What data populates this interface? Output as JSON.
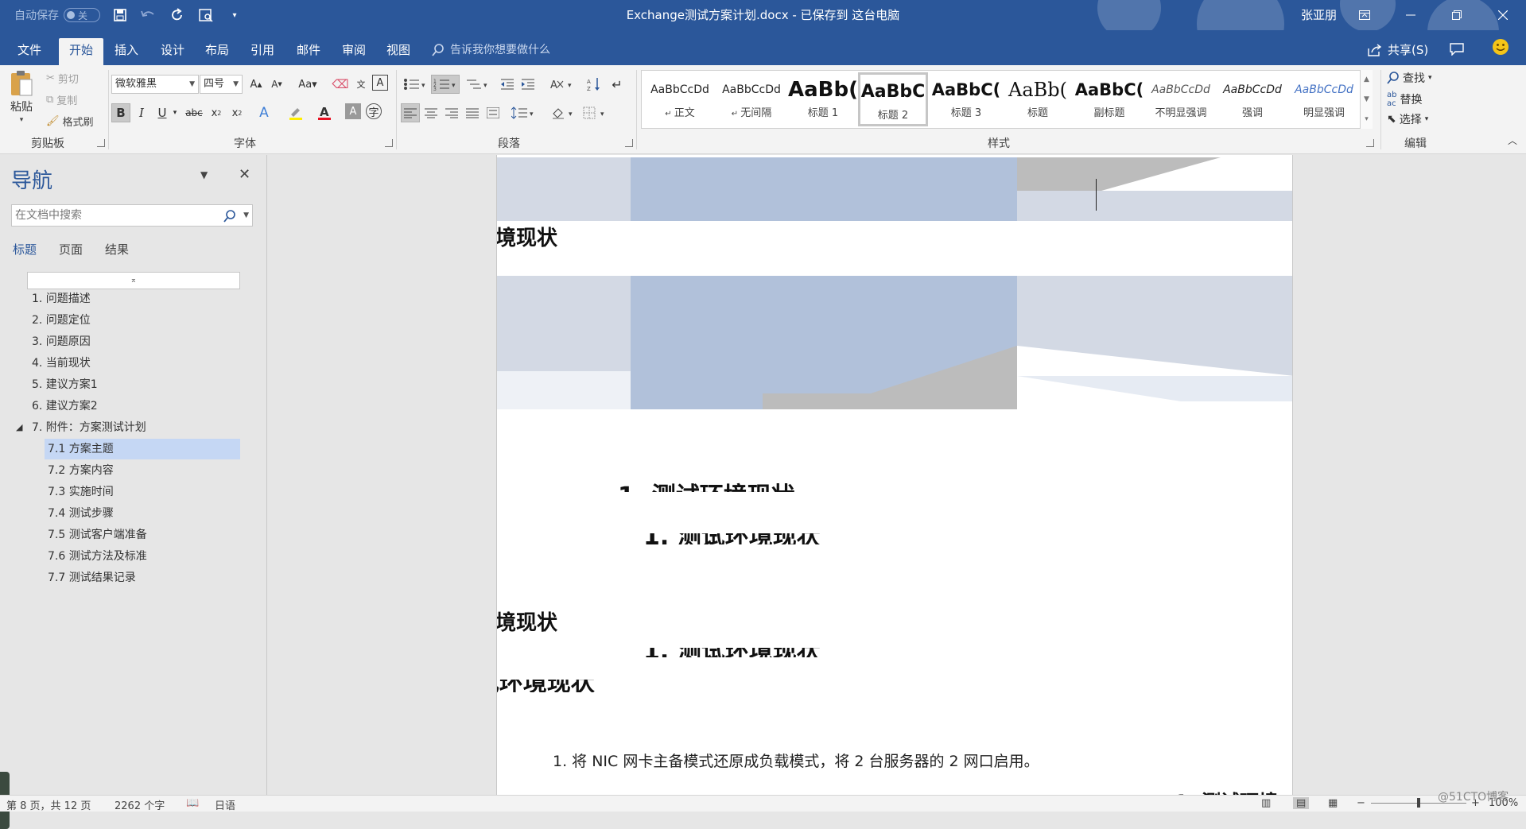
{
  "window": {
    "autosave_label": "自动保存",
    "autosave_state": "关",
    "doc_title": "Exchange测试方案计划.docx - 已保存到 这台电脑",
    "user": "张亚朋"
  },
  "tabs": [
    "文件",
    "开始",
    "插入",
    "设计",
    "布局",
    "引用",
    "邮件",
    "审阅",
    "视图"
  ],
  "active_tab": "开始",
  "tell_me": "告诉我你想要做什么",
  "share_label": "共享(S)",
  "clipboard": {
    "paste": "粘贴",
    "cut": "剪切",
    "copy": "复制",
    "format_painter": "格式刷",
    "group": "剪贴板"
  },
  "font": {
    "name": "微软雅黑",
    "size": "四号",
    "group": "字体"
  },
  "paragraph": {
    "group": "段落"
  },
  "styles": {
    "group": "样式",
    "items": [
      {
        "preview": "AaBbCcDd",
        "name": "正文"
      },
      {
        "preview": "AaBbCcDd",
        "name": "无间隔"
      },
      {
        "preview": "AaBb(",
        "name": "标题 1"
      },
      {
        "preview": "AaBbC",
        "name": "标题 2"
      },
      {
        "preview": "AaBbC(",
        "name": "标题 3"
      },
      {
        "preview": "AaBb(",
        "name": "标题"
      },
      {
        "preview": "AaBbC(",
        "name": "副标题"
      },
      {
        "preview": "AaBbCcDd",
        "name": "不明显强调"
      },
      {
        "preview": "AaBbCcDd",
        "name": "强调"
      },
      {
        "preview": "AaBbCcDd",
        "name": "明显强调"
      }
    ],
    "selected": "标题 2"
  },
  "editing": {
    "group": "编辑",
    "find": "查找",
    "replace": "替换",
    "select": "选择"
  },
  "nav": {
    "title": "导航",
    "search_placeholder": "在文档中搜索",
    "tabs": [
      "标题",
      "页面",
      "结果"
    ],
    "active_tab": "标题",
    "headings": [
      {
        "label": "1. 问题描述",
        "level": 1
      },
      {
        "label": "2. 问题定位",
        "level": 1
      },
      {
        "label": "3. 问题原因",
        "level": 1
      },
      {
        "label": "4. 当前现状",
        "level": 1
      },
      {
        "label": "5. 建议方案1",
        "level": 1
      },
      {
        "label": "6. 建议方案2",
        "level": 1
      },
      {
        "label": "7. 附件：方案测试计划",
        "level": 1,
        "expanded": true
      },
      {
        "label": "7.1 方案主题",
        "level": 2,
        "selected": true
      },
      {
        "label": "7.2 方案内容",
        "level": 2
      },
      {
        "label": "7.3 实施时间",
        "level": 2
      },
      {
        "label": "7.4 测试步骤",
        "level": 2
      },
      {
        "label": "7.5 测试客户端准备",
        "level": 2
      },
      {
        "label": "7.6 测试方法及标准",
        "level": 2
      },
      {
        "label": "7.7 测试结果记录",
        "level": 2
      }
    ]
  },
  "document": {
    "heading_fragment_1": "境现状",
    "heading_fragment_2": "境现状",
    "ghost_heading": "1. 测试环境现状",
    "list_item": "1.   将 NIC 网卡主备模式还原成负载模式，将 2 台服务器的 2 网口启用。",
    "ghost_tail": "1. 测试环境"
  },
  "status": {
    "page": "第 8 页，共 12 页",
    "words": "2262 个字",
    "language": "日语",
    "zoom": "100%"
  },
  "watermark": "@51CTO博客",
  "colors": {
    "brand": "#2b579a",
    "band_gray": "#d3d9e4",
    "band_blue": "#b1c1da",
    "band_mid": "#bcbcbc"
  }
}
